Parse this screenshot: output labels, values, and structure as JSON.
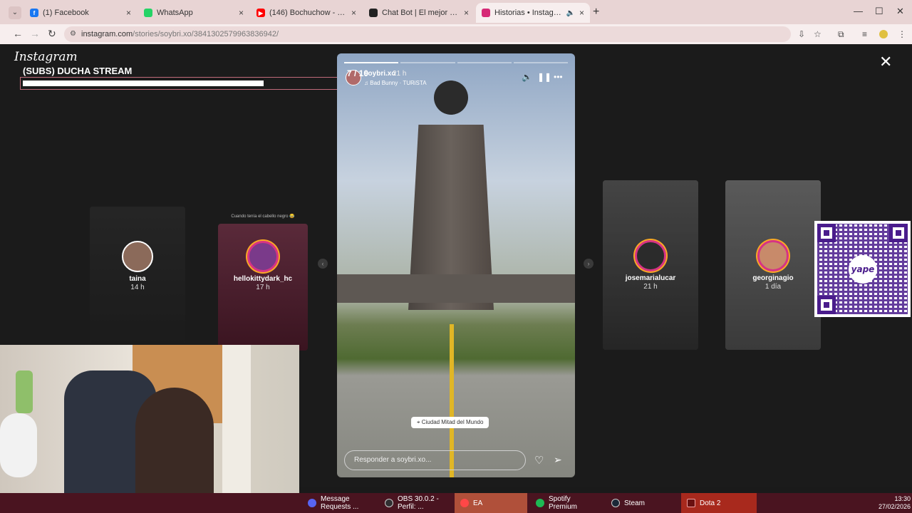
{
  "browser": {
    "tabs": [
      {
        "label": "(1) Facebook",
        "icon": "facebook-icon",
        "color": "#1877f2"
      },
      {
        "label": "WhatsApp",
        "icon": "whatsapp-icon",
        "color": "#25d366"
      },
      {
        "label": "(146) Bochuchow - YouTube",
        "icon": "youtube-icon",
        "color": "#ff0000"
      },
      {
        "label": "Chat Bot | El mejor software pa",
        "icon": "chatbot-icon",
        "color": "#222222"
      },
      {
        "label": "Historias • Instagram",
        "icon": "instagram-icon",
        "color": "#d62976"
      }
    ],
    "url_host": "instagram.com",
    "url_path": "/stories/soybri.xo/3841302579963836942/"
  },
  "instagram": {
    "logo": "Instagram",
    "overlay_title": "(SUBS) DUCHA STREAM",
    "overlay_progress": 0.69,
    "left_stories": [
      {
        "username": "taina",
        "time": "14 h"
      },
      {
        "username": "hellokittydark_hc",
        "time": "17 h",
        "caption": "Cuando tenía el cabello negro 😂"
      }
    ],
    "right_stories": [
      {
        "username": "josemarialucar",
        "time": "21 h"
      },
      {
        "username": "georginagio",
        "time": "1 día"
      }
    ],
    "main_story": {
      "counter": "7 / 10",
      "username": "soybri.xo",
      "time": "21 h",
      "music": "Bad Bunny · TURiSTA",
      "segments_total": 4,
      "segments_done": 1,
      "location": "Ciudad Mitad del Mundo",
      "reply_placeholder": "Responder a soybri.xo..."
    }
  },
  "taskbar": {
    "items": [
      {
        "label": "Message Requests ...",
        "color": "#5865f2"
      },
      {
        "label": "OBS 30.0.2 - Perfil: ...",
        "color": "#302e31"
      },
      {
        "label": "EA",
        "color": "#ff4747"
      },
      {
        "label": "Spotify Premium",
        "color": "#1db954"
      },
      {
        "label": "Steam",
        "color": "#1b2838"
      },
      {
        "label": "Dota 2",
        "color": "#a8291d"
      }
    ],
    "time": "13:30",
    "date": "27/02/2026"
  }
}
